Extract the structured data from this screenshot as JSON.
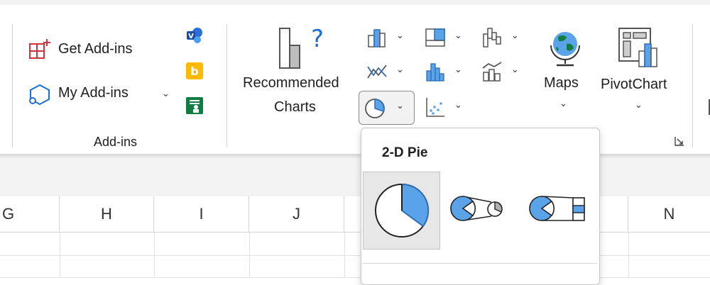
{
  "ribbon": {
    "addins_group": {
      "get_addins_label": "Get Add-ins",
      "my_addins_label": "My Add-ins",
      "group_label": "Add-ins",
      "apps": [
        "visio-icon",
        "bing-icon",
        "people-graph-icon"
      ]
    },
    "charts_group": {
      "recommended_line1": "Recommended",
      "recommended_line2": "Charts",
      "maps_label": "Maps",
      "pivotchart_label": "PivotChart",
      "chart_type_buttons": [
        "column-chart-icon",
        "hierarchy-chart-icon",
        "waterfall-chart-icon",
        "line-chart-icon",
        "statistic-chart-icon",
        "combo-chart-icon",
        "pie-chart-icon",
        "scatter-chart-icon"
      ]
    }
  },
  "dropdown": {
    "section_title": "2-D Pie",
    "options": [
      "pie-icon",
      "pie-of-pie-icon",
      "bar-of-pie-icon"
    ]
  },
  "sheet": {
    "columns": [
      "G",
      "H",
      "I",
      "J",
      "N"
    ]
  },
  "colors": {
    "accent_blue": "#5aa3e8",
    "office_red": "#d13438",
    "bing_orange": "#ffb900",
    "excel_green": "#107c41"
  }
}
